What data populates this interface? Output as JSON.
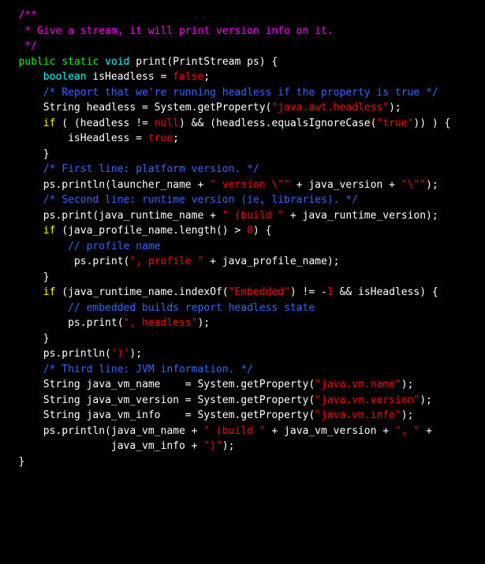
{
  "code": {
    "l01": "   /**",
    "l02": "    * Give a stream, it will print version info on it.",
    "l03": "    */",
    "l04a": "   public",
    "l04b": " static",
    "l04c": " void",
    "l04d": " print(PrintStream ps) {",
    "l05a": "       boolean",
    "l05b": " isHeadless = ",
    "l05c": "false",
    "l05d": ";",
    "l06": "",
    "l07": "       /* Report that we're running headless if the property is true */",
    "l08a": "       String headless = System.getProperty(",
    "l08b": "\"java.awt.headless\"",
    "l08c": ");",
    "l09a": "       if",
    "l09b": " ( (headless != ",
    "l09c": "null",
    "l09d": ") && (headless.equalsIgnoreCase(",
    "l09e": "\"true\"",
    "l09f": ")) ) {",
    "l10a": "           isHeadless = ",
    "l10b": "true",
    "l10c": ";",
    "l11": "       }",
    "l12": "",
    "l13": "       /* First line: platform version. */",
    "l14a": "       ps.println(launcher_name + ",
    "l14b": "\" version \\\"\"",
    "l14c": " + java_version + ",
    "l14d": "\"\\\"\"",
    "l14e": ");",
    "l15": "",
    "l16": "       /* Second line: runtime version (ie, libraries). */",
    "l17": "",
    "l18a": "       ps.print(java_runtime_name + ",
    "l18b": "\" (build \"",
    "l18c": " + java_runtime_version);",
    "l19": "",
    "l20a": "       if",
    "l20b": " (java_profile_name.length() > ",
    "l20c": "0",
    "l20d": ") {",
    "l21": "           // profile name",
    "l22a": "            ps.print(",
    "l22b": "\", profile \"",
    "l22c": " + java_profile_name);",
    "l23": "       }",
    "l24": "",
    "l25a": "       if",
    "l25b": " (java_runtime_name.indexOf(",
    "l25c": "\"Embedded\"",
    "l25d": ") != -",
    "l25e": "1",
    "l25f": " && isHeadless) {",
    "l26": "           // embedded builds report headless state",
    "l27a": "           ps.print(",
    "l27b": "\", headless\"",
    "l27c": ");",
    "l28": "       }",
    "l29a": "       ps.println(",
    "l29b": "')'",
    "l29c": ");",
    "l30": "",
    "l31": "       /* Third line: JVM information. */",
    "l32a": "       String java_vm_name    = System.getProperty(",
    "l32b": "\"java.vm.name\"",
    "l32c": ");",
    "l33a": "       String java_vm_version = System.getProperty(",
    "l33b": "\"java.vm.version\"",
    "l33c": ");",
    "l34a": "       String java_vm_info    = System.getProperty(",
    "l34b": "\"java.vm.info\"",
    "l34c": ");",
    "l35a": "       ps.println(java_vm_name + ",
    "l35b": "\" (build \"",
    "l35c": " + java_vm_version + ",
    "l35d": "\", \"",
    "l35e": " +",
    "l36a": "                  java_vm_info + ",
    "l36b": "\")\"",
    "l36c": ");",
    "l37": "   }"
  }
}
